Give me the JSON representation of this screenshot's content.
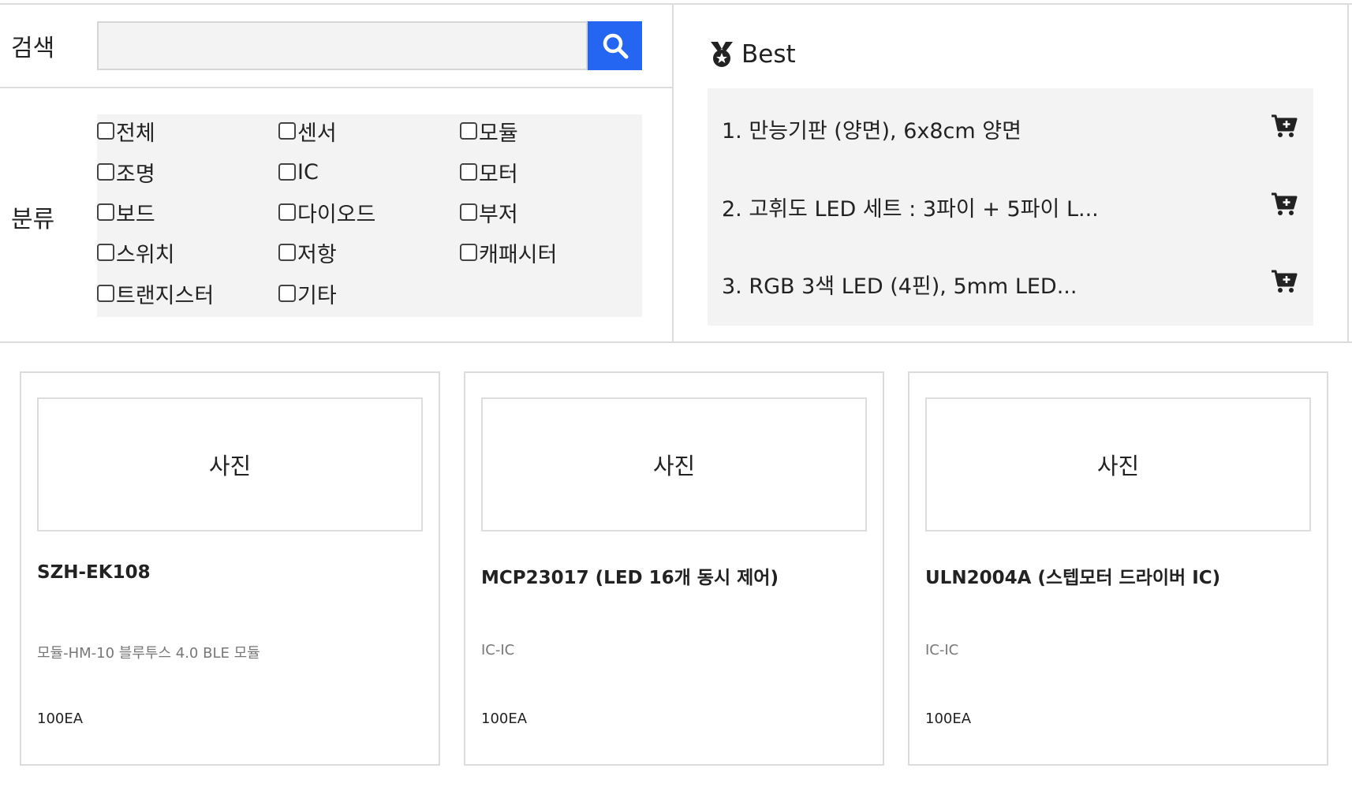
{
  "search": {
    "label": "검색",
    "value": "",
    "placeholder": "",
    "button_icon": "search-icon",
    "button_color": "#2466f2"
  },
  "category": {
    "label": "분류",
    "items": [
      {
        "label": "전체",
        "checked": false
      },
      {
        "label": "센서",
        "checked": false
      },
      {
        "label": "모듈",
        "checked": false
      },
      {
        "label": "조명",
        "checked": false
      },
      {
        "label": "IC",
        "checked": false
      },
      {
        "label": "모터",
        "checked": false
      },
      {
        "label": "보드",
        "checked": false
      },
      {
        "label": "다이오드",
        "checked": false
      },
      {
        "label": "부저",
        "checked": false
      },
      {
        "label": "스위치",
        "checked": false
      },
      {
        "label": "저항",
        "checked": false
      },
      {
        "label": "캐패시터",
        "checked": false
      },
      {
        "label": "트랜지스터",
        "checked": false
      },
      {
        "label": "기타",
        "checked": false
      }
    ]
  },
  "best": {
    "icon": "medal-icon",
    "title": "Best",
    "items": [
      {
        "text": "1. 만능기판 (양면), 6x8cm 양면",
        "icon": "cart-icon"
      },
      {
        "text": "2. 고휘도 LED 세트 : 3파이 + 5파이 L...",
        "icon": "cart-icon"
      },
      {
        "text": "3. RGB 3색 LED (4핀), 5mm LED...",
        "icon": "cart-icon"
      }
    ]
  },
  "products": [
    {
      "photo": "사진",
      "name": "SZH-EK108",
      "category": "모듈-HM-10 블루투스 4.0 BLE 모듈",
      "stock": "100EA"
    },
    {
      "photo": "사진",
      "name": "MCP23017 (LED 16개 동시 제어)",
      "category": "IC-IC",
      "stock": "100EA"
    },
    {
      "photo": "사진",
      "name": "ULN2004A (스텝모터 드라이버 IC)",
      "category": "IC-IC",
      "stock": "100EA"
    }
  ]
}
